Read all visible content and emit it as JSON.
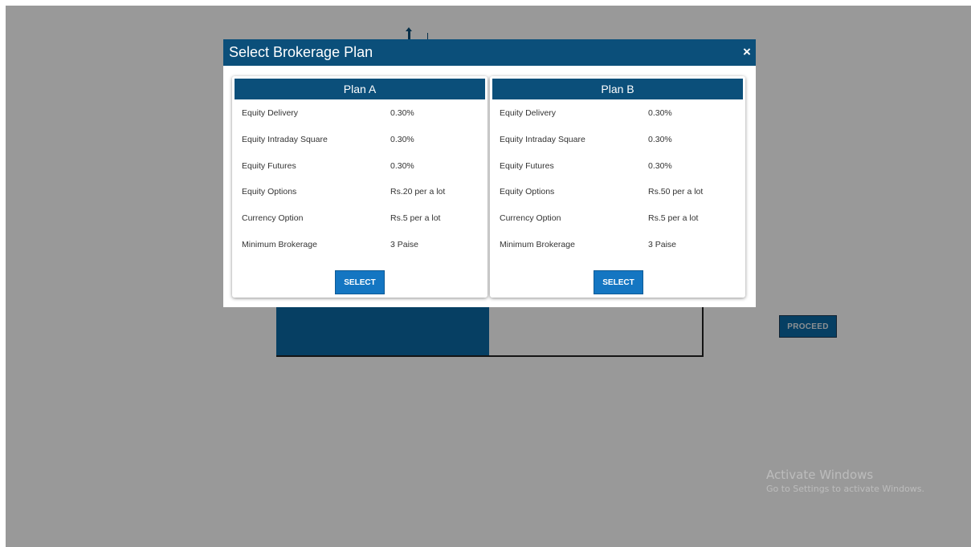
{
  "modal": {
    "title": "Select Brokerage Plan",
    "close_label": "×"
  },
  "plans": [
    {
      "name": "Plan A",
      "rows": [
        {
          "label": "Equity Delivery",
          "value": "0.30%"
        },
        {
          "label": "Equity Intraday Square",
          "value": "0.30%"
        },
        {
          "label": "Equity Futures",
          "value": "0.30%"
        },
        {
          "label": "Equity Options",
          "value": "Rs.20 per a lot"
        },
        {
          "label": "Currency Option",
          "value": "Rs.5 per a lot"
        },
        {
          "label": "Minimum Brokerage",
          "value": "3 Paise"
        }
      ],
      "select_label": "SELECT"
    },
    {
      "name": "Plan B",
      "rows": [
        {
          "label": "Equity Delivery",
          "value": "0.30%"
        },
        {
          "label": "Equity Intraday Square",
          "value": "0.30%"
        },
        {
          "label": "Equity Futures",
          "value": "0.30%"
        },
        {
          "label": "Equity Options",
          "value": "Rs.50 per a lot"
        },
        {
          "label": "Currency Option",
          "value": "Rs.5 per a lot"
        },
        {
          "label": "Minimum Brokerage",
          "value": "3 Paise"
        }
      ],
      "select_label": "SELECT"
    }
  ],
  "background": {
    "proceed_label": "PROCEED"
  },
  "watermark": {
    "line1": "Activate Windows",
    "line2": "Go to Settings to activate Windows."
  },
  "colors": {
    "header": "#0b4f7a",
    "button": "#1476c2",
    "overlay": "rgba(0,0,0,0.4)"
  }
}
